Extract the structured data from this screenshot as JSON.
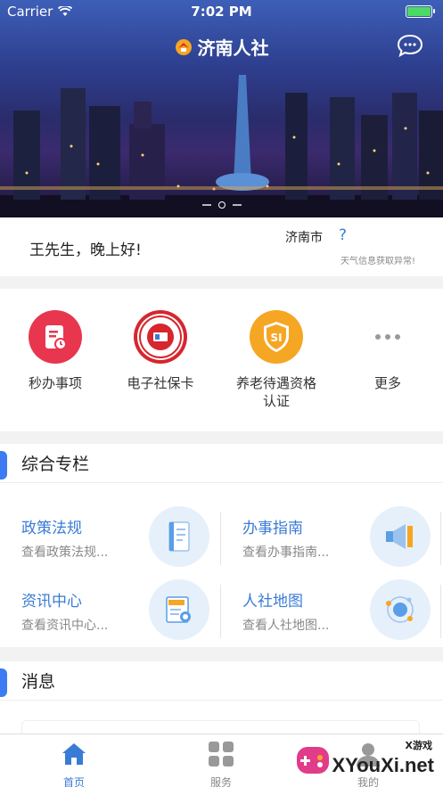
{
  "status_bar": {
    "carrier": "Carrier",
    "time": "7:02 PM"
  },
  "header": {
    "title": "济南人社",
    "chat_icon": "chat-bubble-icon"
  },
  "greeting": {
    "hello": "王先生，晚上好!",
    "city": "济南市",
    "weather_icon": "?",
    "weather_status": "天气信息获取异常!"
  },
  "quick_menu": [
    {
      "label": "秒办事项",
      "icon": "document-icon",
      "color": "#e8364f"
    },
    {
      "label": "电子社保卡",
      "icon": "social-security-card-icon",
      "color": "#d7262e"
    },
    {
      "label": "养老待遇资格\n认证",
      "icon": "si-shield-icon",
      "color": "#f5a623"
    },
    {
      "label": "更多",
      "icon": "more-dots-icon",
      "color": "#999999"
    }
  ],
  "column_section": {
    "title": "综合专栏",
    "items": [
      {
        "title": "政策法规",
        "subtitle": "查看政策法规...",
        "icon": "book-icon"
      },
      {
        "title": "办事指南",
        "subtitle": "查看办事指南...",
        "icon": "megaphone-icon"
      },
      {
        "title": "资讯中心",
        "subtitle": "查看资讯中心...",
        "icon": "news-icon"
      },
      {
        "title": "人社地图",
        "subtitle": "查看人社地图...",
        "icon": "map-orbit-icon"
      }
    ]
  },
  "message_section": {
    "title": "消息"
  },
  "tabbar": [
    {
      "label": "首页",
      "icon": "home-icon",
      "active": true
    },
    {
      "label": "服务",
      "icon": "grid-icon",
      "active": false
    },
    {
      "label": "我的",
      "icon": "user-icon",
      "active": false
    }
  ],
  "watermark": {
    "brand_small": "X游戏",
    "brand": "XYouXi.net"
  },
  "colors": {
    "accent": "#3a7bd5",
    "section_bar": "#3d7bf2"
  }
}
